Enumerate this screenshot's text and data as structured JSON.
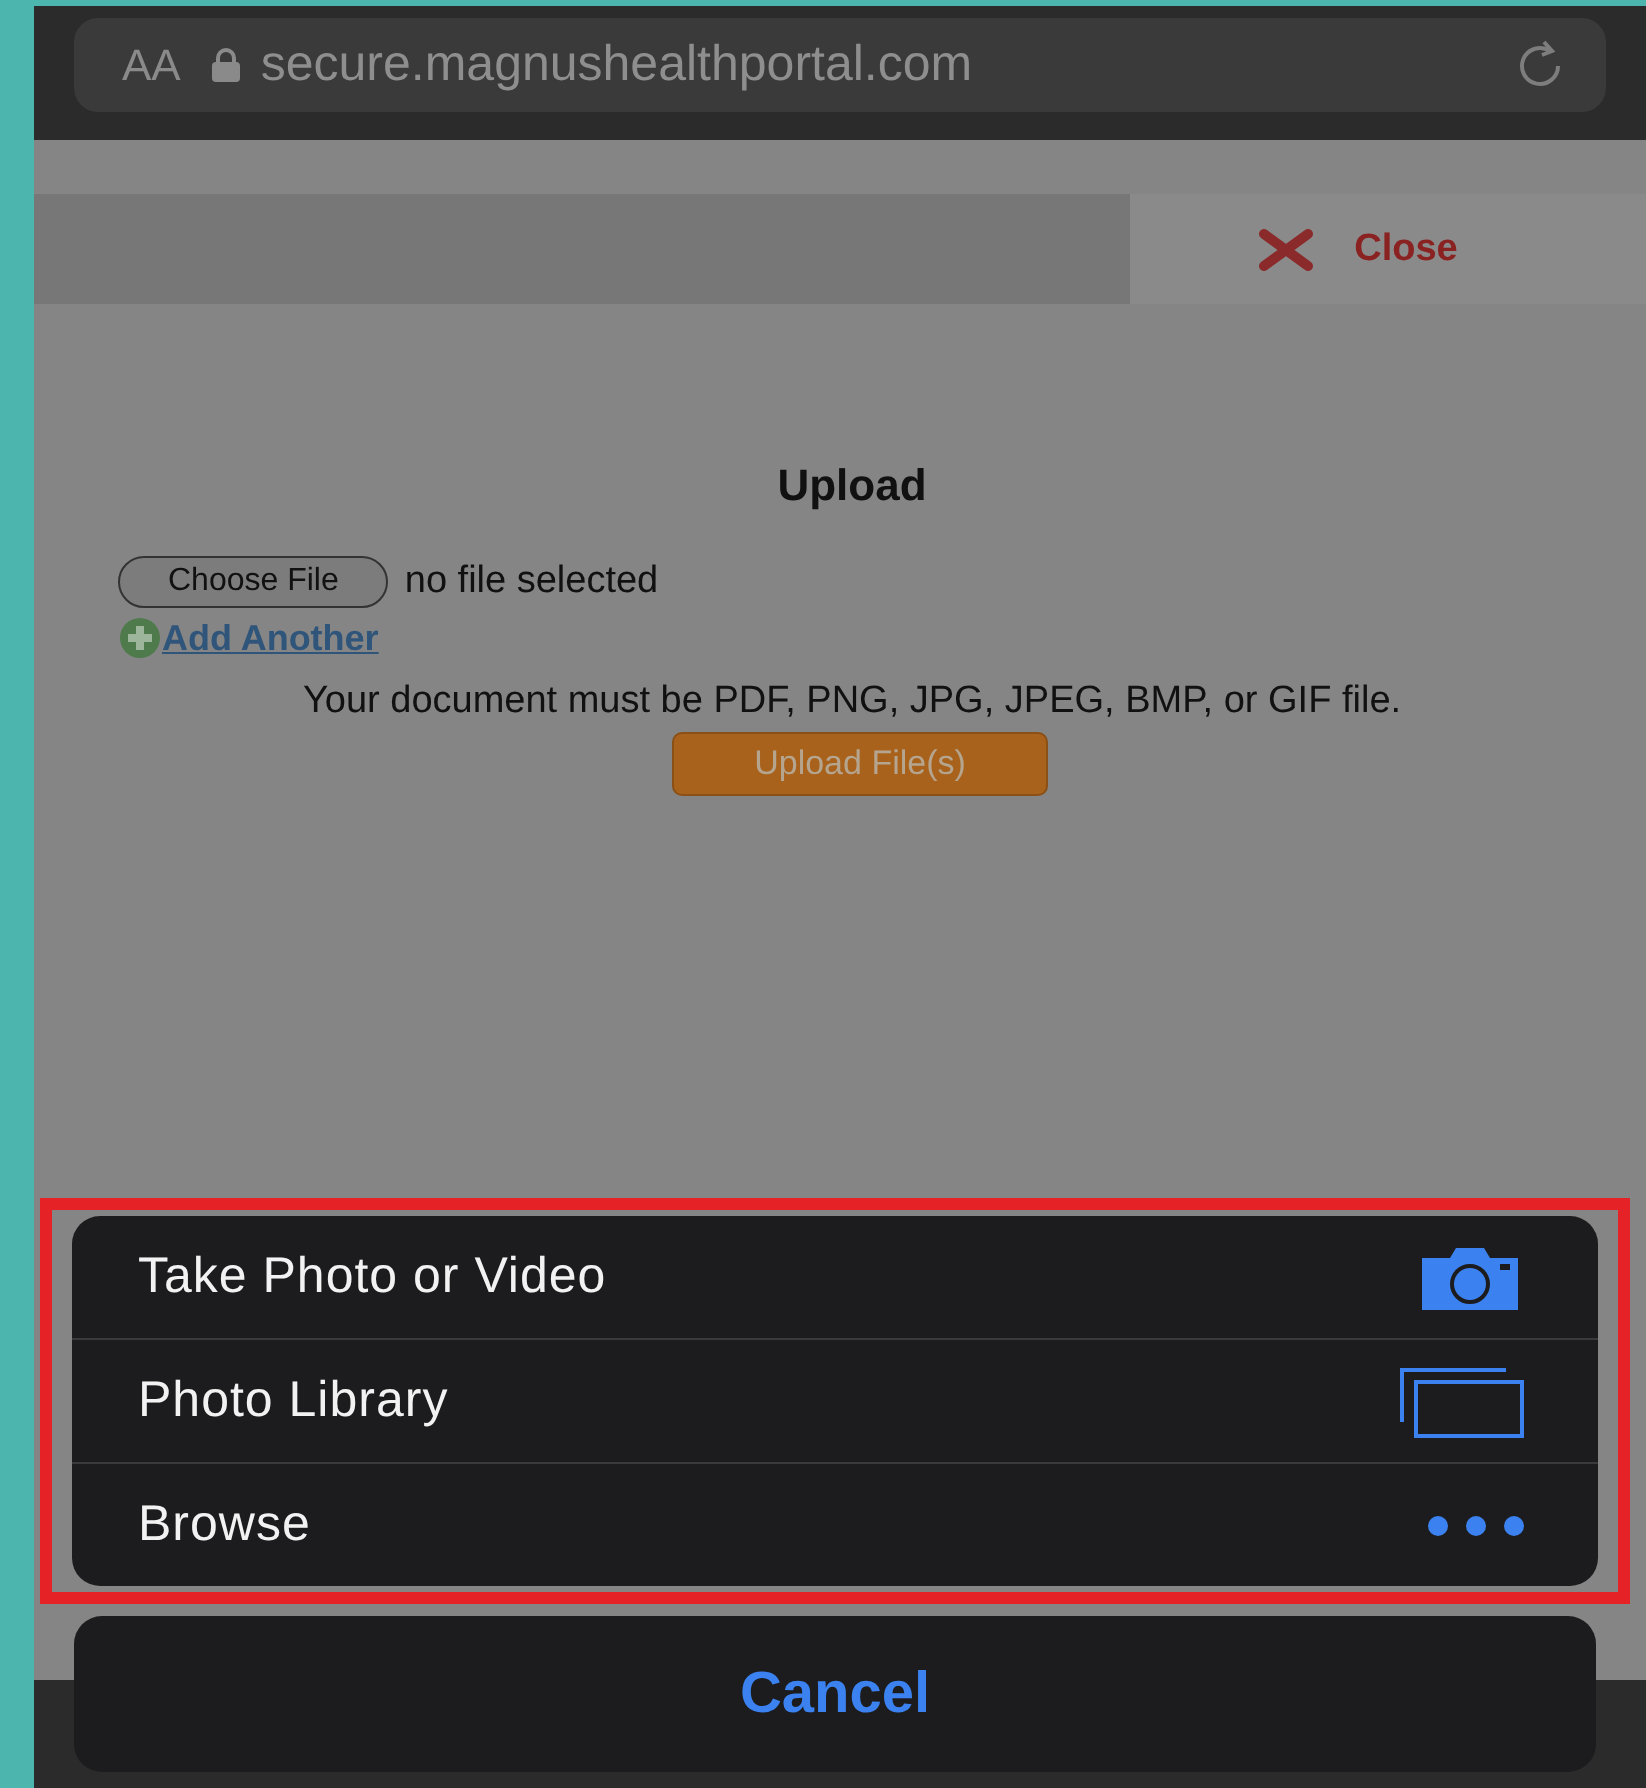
{
  "address_bar": {
    "text_size": "AA",
    "url": "secure.magnushealthportal.com"
  },
  "header": {
    "close_label": "Close"
  },
  "upload": {
    "title": "Upload",
    "choose_button": "Choose File",
    "file_status": "no file selected",
    "add_link": "Add Another",
    "note": "Your document must be PDF, PNG, JPG, JPEG, BMP, or GIF file.",
    "upload_button": "Upload File(s)"
  },
  "action_sheet": {
    "highlighted": true,
    "items": [
      {
        "label": "Take Photo or Video",
        "kind": "camera"
      },
      {
        "label": "Photo Library",
        "kind": "library"
      },
      {
        "label": "Browse",
        "kind": "more"
      }
    ],
    "cancel": "Cancel"
  }
}
